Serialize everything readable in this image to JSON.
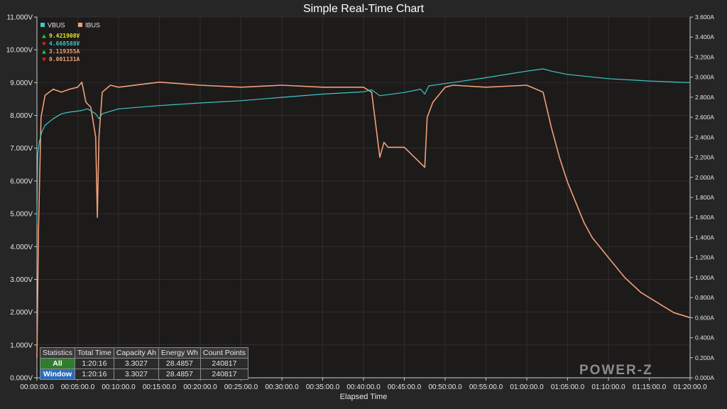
{
  "colors": {
    "vbus": "#3cc8c8",
    "ibus": "#f0a078",
    "background": "#1d1a1a",
    "grid": "#3a3a3a",
    "up_arrow": "#22cc22",
    "down_arrow": "#dd2222",
    "max_vbus": "#e8e820"
  },
  "chart_data": {
    "type": "line",
    "title": "Simple Real-Time Chart",
    "xlabel": "Elapsed Time",
    "x_unit": "minutes",
    "xlim": [
      0,
      80
    ],
    "x_tick_labels": [
      "00:00:00.0",
      "00:05:00.0",
      "00:10:00.0",
      "00:15:00.0",
      "00:20:00.0",
      "00:25:00.0",
      "00:30:00.0",
      "00:35:00.0",
      "00:40:00.0",
      "00:45:00.0",
      "00:50:00.0",
      "00:55:00.0",
      "01:00:00.0",
      "01:05:00.0",
      "01:10:00.0",
      "01:15:00.0",
      "01:20:00.0"
    ],
    "y_left": {
      "label": "",
      "lim": [
        0,
        11
      ],
      "tick_labels": [
        "0.000V",
        "1.000V",
        "2.000V",
        "3.000V",
        "4.000V",
        "5.000V",
        "6.000V",
        "7.000V",
        "8.000V",
        "9.000V",
        "10.000V",
        "11.000V"
      ]
    },
    "y_right": {
      "label": "",
      "lim": [
        0,
        3.6
      ],
      "tick_labels": [
        "0.000A",
        "0.200A",
        "0.400A",
        "0.600A",
        "0.800A",
        "1.000A",
        "1.200A",
        "1.400A",
        "1.600A",
        "1.800A",
        "2.000A",
        "2.200A",
        "2.400A",
        "2.600A",
        "2.800A",
        "3.000A",
        "3.200A",
        "3.400A",
        "3.600A"
      ]
    },
    "grid": true,
    "legend_position": "top-left",
    "series": [
      {
        "name": "VBUS",
        "axis": "left",
        "unit": "V",
        "x": [
          0,
          0.1,
          0.3,
          0.6,
          1,
          2,
          3,
          4,
          5.5,
          6.2,
          7.2,
          7.6,
          8,
          10,
          15,
          20,
          25,
          30,
          35,
          40,
          41,
          42,
          45,
          47,
          47.5,
          48,
          50,
          55,
          60,
          62,
          63,
          65,
          70,
          75,
          80
        ],
        "y": [
          4.7,
          6.8,
          7.2,
          7.5,
          7.7,
          7.9,
          8.05,
          8.1,
          8.15,
          8.2,
          8.05,
          7.9,
          8.05,
          8.2,
          8.3,
          8.38,
          8.45,
          8.55,
          8.65,
          8.72,
          8.78,
          8.6,
          8.7,
          8.8,
          8.65,
          8.9,
          8.97,
          9.15,
          9.35,
          9.42,
          9.35,
          9.25,
          9.12,
          9.05,
          9.0
        ]
      },
      {
        "name": "IBUS",
        "axis": "right",
        "unit": "A",
        "x": [
          0,
          0.2,
          0.5,
          1,
          2,
          3,
          4,
          5,
          5.5,
          6,
          6.6,
          7.2,
          7.4,
          7.6,
          8,
          9,
          10,
          15,
          20,
          25,
          30,
          35,
          40,
          41,
          42,
          42.5,
          43,
          45,
          47.5,
          47.8,
          48.5,
          50,
          51,
          55,
          60,
          62,
          63,
          64,
          65,
          66,
          67,
          68,
          70,
          72,
          74,
          76,
          78,
          80
        ],
        "y": [
          0.2,
          1.5,
          2.6,
          2.82,
          2.88,
          2.85,
          2.88,
          2.9,
          2.95,
          2.75,
          2.7,
          2.4,
          1.6,
          2.4,
          2.85,
          2.92,
          2.9,
          2.95,
          2.92,
          2.9,
          2.92,
          2.9,
          2.9,
          2.85,
          2.2,
          2.35,
          2.3,
          2.3,
          2.1,
          2.6,
          2.75,
          2.9,
          2.92,
          2.9,
          2.92,
          2.85,
          2.5,
          2.2,
          1.95,
          1.75,
          1.55,
          1.4,
          1.2,
          1.0,
          0.85,
          0.75,
          0.65,
          0.6
        ]
      }
    ],
    "min_max": [
      {
        "dir": "up",
        "text": "9.421908V",
        "series": "VBUS"
      },
      {
        "dir": "down",
        "text": "4.668588V",
        "series": "VBUS"
      },
      {
        "dir": "up",
        "text": "3.119355A",
        "series": "IBUS"
      },
      {
        "dir": "down",
        "text": "0.001131A",
        "series": "IBUS"
      }
    ]
  },
  "stats": {
    "headers": [
      "Statistics",
      "Total Time",
      "Capacity Ah",
      "Energy Wh",
      "Count Points"
    ],
    "rows": [
      {
        "label": "All",
        "total_time": "1:20:16",
        "capacity": "3.3027",
        "energy": "28.4857",
        "count": "240817"
      },
      {
        "label": "Window",
        "total_time": "1:20:16",
        "capacity": "3.3027",
        "energy": "28.4857",
        "count": "240817"
      }
    ]
  },
  "logo": {
    "text": "POWER-Z"
  }
}
